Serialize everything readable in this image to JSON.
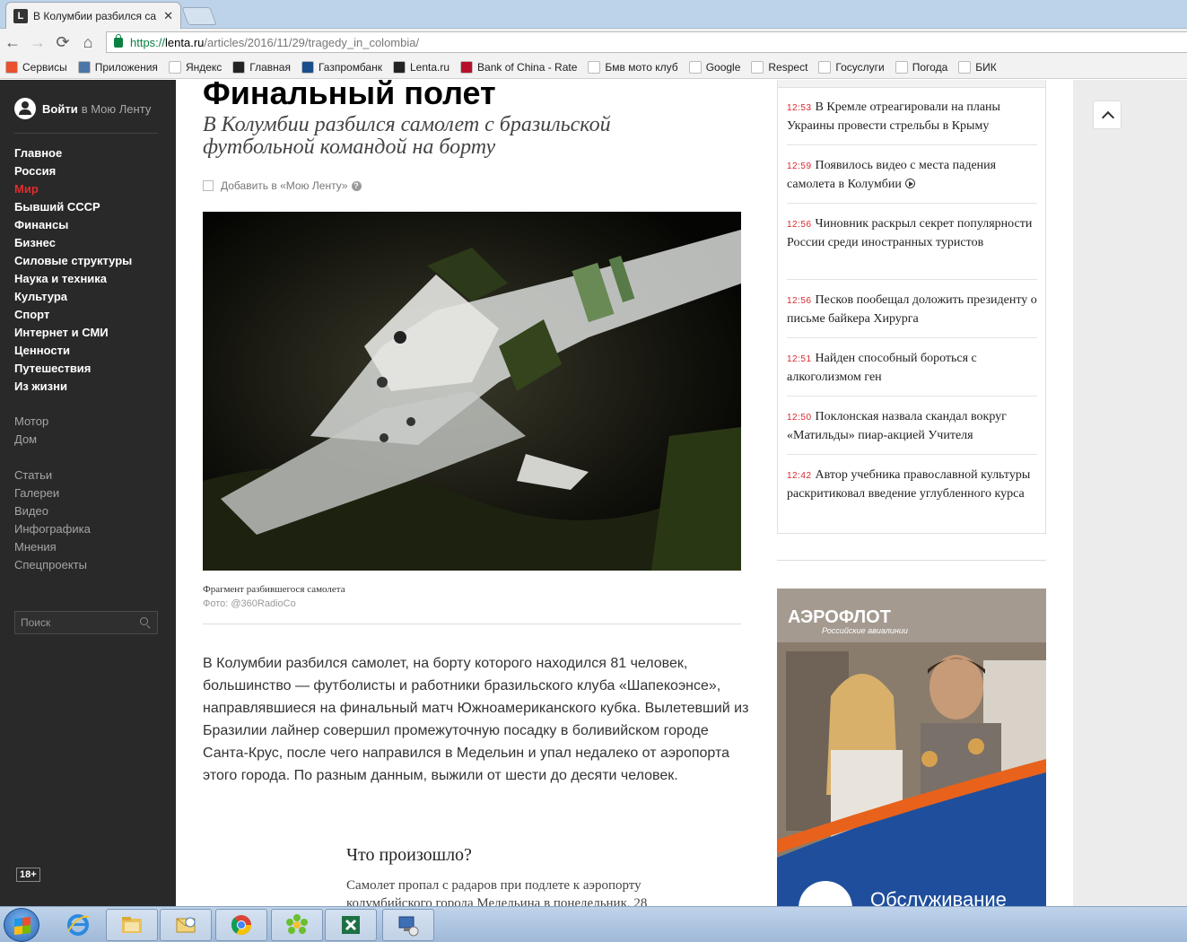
{
  "browser": {
    "tab_title": "В Колумбии разбился са",
    "tab_favicon": "L",
    "url_scheme": "https://",
    "url_host": "lenta.ru",
    "url_path": "/articles/2016/11/29/tragedy_in_colombia/",
    "bookmarks": [
      {
        "label": "Сервисы",
        "icon": "apps-grid-icon",
        "color": "#e8502e"
      },
      {
        "label": "Приложения",
        "icon": "vk-icon",
        "color": "#4a76a8"
      },
      {
        "label": "Яндекс",
        "icon": "yandex-icon",
        "color": "#ffffff"
      },
      {
        "label": "Главная",
        "icon": "site-icon",
        "color": "#222222"
      },
      {
        "label": "Газпромбанк",
        "icon": "gazprombank-icon",
        "color": "#1a4e8a"
      },
      {
        "label": "Lenta.ru",
        "icon": "lenta-icon",
        "color": "#222222"
      },
      {
        "label": "Bank of China - Rate",
        "icon": "bank-of-china-icon",
        "color": "#b8102c"
      },
      {
        "label": "Бмв мото клуб",
        "icon": "bmw-icon",
        "color": "#ffffff"
      },
      {
        "label": "Google",
        "icon": "google-icon",
        "color": "#ffffff"
      },
      {
        "label": "Respect",
        "icon": "respect-icon",
        "color": "#ffffff"
      },
      {
        "label": "Госуслуги",
        "icon": "russia-flag-icon",
        "color": "#ffffff"
      },
      {
        "label": "Погода",
        "icon": "weather-drop-icon",
        "color": "#ffffff"
      },
      {
        "label": "БИК",
        "icon": "book-icon",
        "color": "#ffffff"
      }
    ]
  },
  "sidebar": {
    "login_bold": "Войти",
    "login_rest": "в Мою Ленту",
    "main_items": [
      "Главное",
      "Россия",
      "Мир",
      "Бывший СССР",
      "Финансы",
      "Бизнес",
      "Силовые структуры",
      "Наука и техника",
      "Культура",
      "Спорт",
      "Интернет и СМИ",
      "Ценности",
      "Путешествия",
      "Из жизни"
    ],
    "active_item": "Мир",
    "extra_items": [
      "Мотор",
      "Дом"
    ],
    "section_items": [
      "Статьи",
      "Галереи",
      "Видео",
      "Инфографика",
      "Мнения",
      "Спецпроекты"
    ],
    "search_placeholder": "Поиск",
    "age_badge": "18+"
  },
  "article": {
    "title": "Финальный полет",
    "subtitle": "В Колумбии разбился самолет с бразильской футбольной командой на борту",
    "add_to_feed": "Добавить в «Мою Ленту»",
    "photo_caption": "Фрагмент разбившегося самолета",
    "photo_credit": "Фото: @360RadioCo",
    "body": "В Колумбии разбился самолет, на борту которого находился 81 человек, большинство — футболисты и работники бразильского клуба «Шапекоэнсе», направлявшиеся на финальный матч Южноамериканского кубка. Вылетевший из Бразилии лайнер совершил промежуточную посадку в боливийском городе Санта-Крус, после чего направился в Медельин и упал недалеко от аэропорта этого города. По разным данным, выжили от шести до десяти человек.",
    "what_happened_title": "Что произошло?",
    "what_happened_text": "Самолет пропал с радаров при подлете к аэропорту колумбийского города Медельина в понедельник, 28"
  },
  "news": [
    {
      "time": "12:53",
      "text": "В Кремле отреагировали на планы Украины провести стрельбы в Крыму",
      "video": false
    },
    {
      "time": "12:59",
      "text": "Появилось видео с места падения самолета в Колумбии",
      "video": true
    },
    {
      "time": "12:56",
      "text": "Чиновник раскрыл секрет популярности России среди иностранных туристов",
      "video": false
    },
    {
      "time": "12:56",
      "text": "Песков пообещал доложить президенту о письме байкера Хирурга",
      "video": false
    },
    {
      "time": "12:51",
      "text": "Найден способный бороться с алкоголизмом ген",
      "video": false
    },
    {
      "time": "12:50",
      "text": "Поклонская назвала скандал вокруг «Матильды» пиар-акцией Учителя",
      "video": false
    },
    {
      "time": "12:42",
      "text": "Автор учебника православной культуры раскритиковал введение углубленного курса",
      "video": false
    }
  ],
  "ad": {
    "brand": "АЭРОФЛОТ",
    "tagline": "Российские авиалинии",
    "bottom_text": "Обслуживание",
    "accent": "#e8621c",
    "blue": "#1f4f9c"
  },
  "taskbar": {
    "apps": [
      "start-orb-icon",
      "internet-explorer-icon",
      "file-explorer-icon",
      "outlook-icon",
      "chrome-icon",
      "icq-icon",
      "excel-icon",
      "network-connection-icon"
    ]
  }
}
